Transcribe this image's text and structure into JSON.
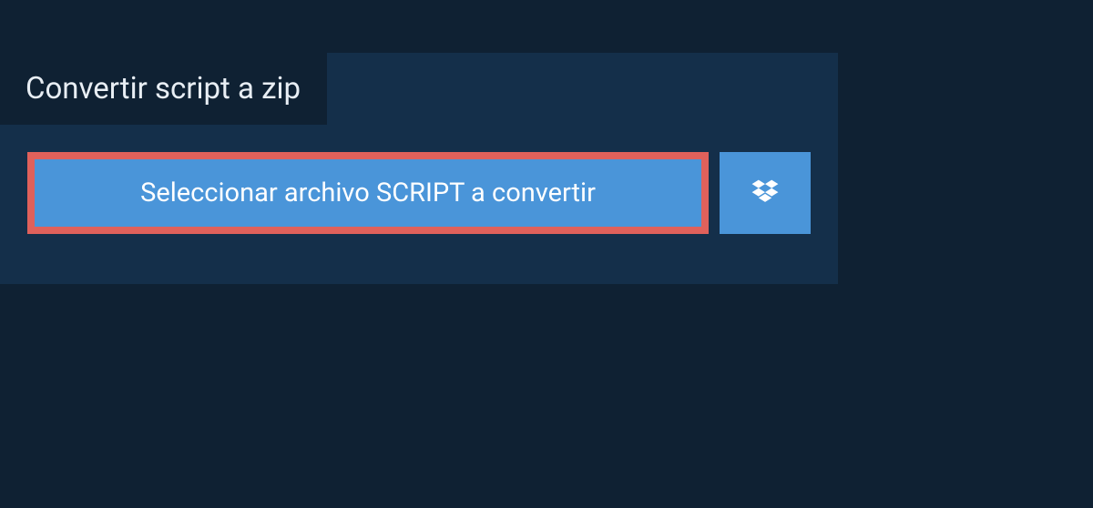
{
  "tab": {
    "title": "Convertir script a zip"
  },
  "buttons": {
    "select_file_label": "Seleccionar archivo SCRIPT a convertir"
  }
}
